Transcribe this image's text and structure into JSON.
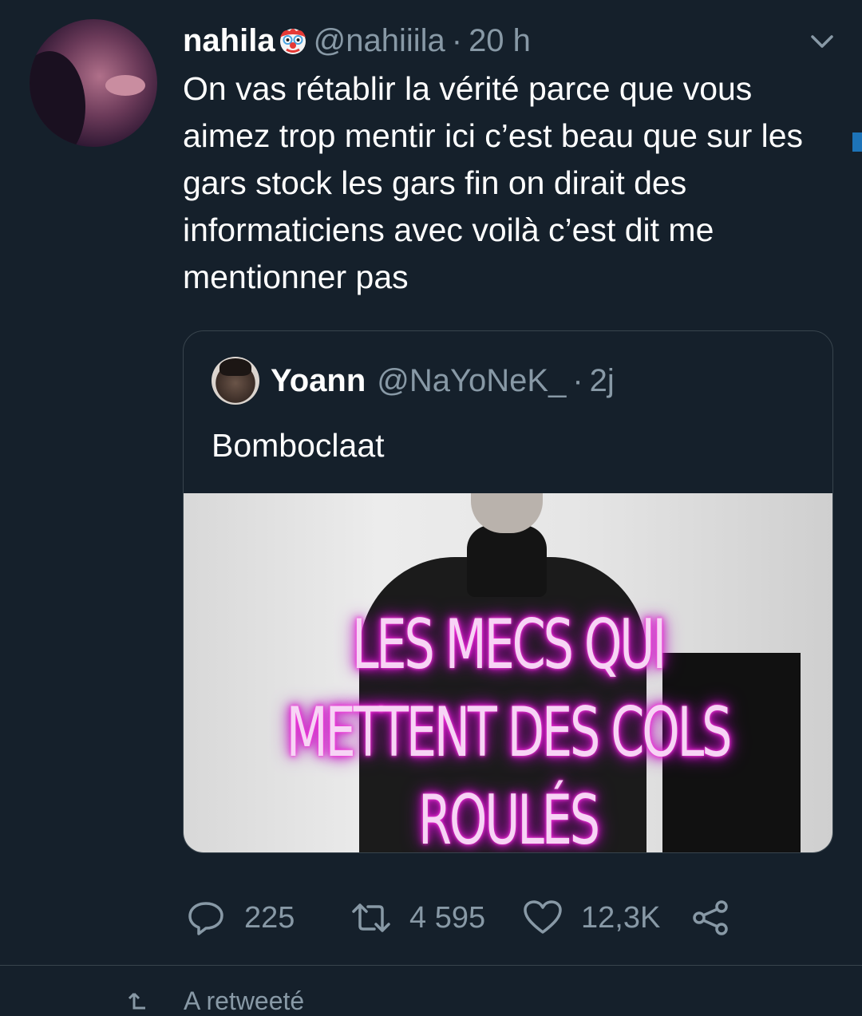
{
  "tweet": {
    "display_name": "nahila",
    "name_emoji": "clown-face",
    "handle": "@nahiiila",
    "separator": "·",
    "time": "20 h",
    "text": "On vas rétablir la vérité parce que vous aimez trop mentir ici c’est beau que sur les gars stock les gars fin on dirait des informaticiens avec voilà c’est dit me mentionner pas"
  },
  "quoted_tweet": {
    "display_name": "Yoann",
    "handle": "@NaYoNeK_",
    "separator": "·",
    "time": "2j",
    "text": "Bomboclaat",
    "image_text": {
      "line1": "LES MECS QUI",
      "line2": "METTENT DES COLS",
      "line3": "ROULÉS"
    }
  },
  "actions": {
    "replies": "225",
    "retweets": "4 595",
    "likes": "12,3K"
  },
  "next_item": {
    "label": "A retweeté"
  },
  "colors": {
    "background": "#15202b",
    "secondary_text": "#8899a6",
    "border": "#38444d",
    "neon": "#e020d0"
  },
  "icons": [
    "chevron-down-icon",
    "reply-icon",
    "retweet-icon",
    "like-icon",
    "share-icon",
    "clown-emoji-icon"
  ]
}
